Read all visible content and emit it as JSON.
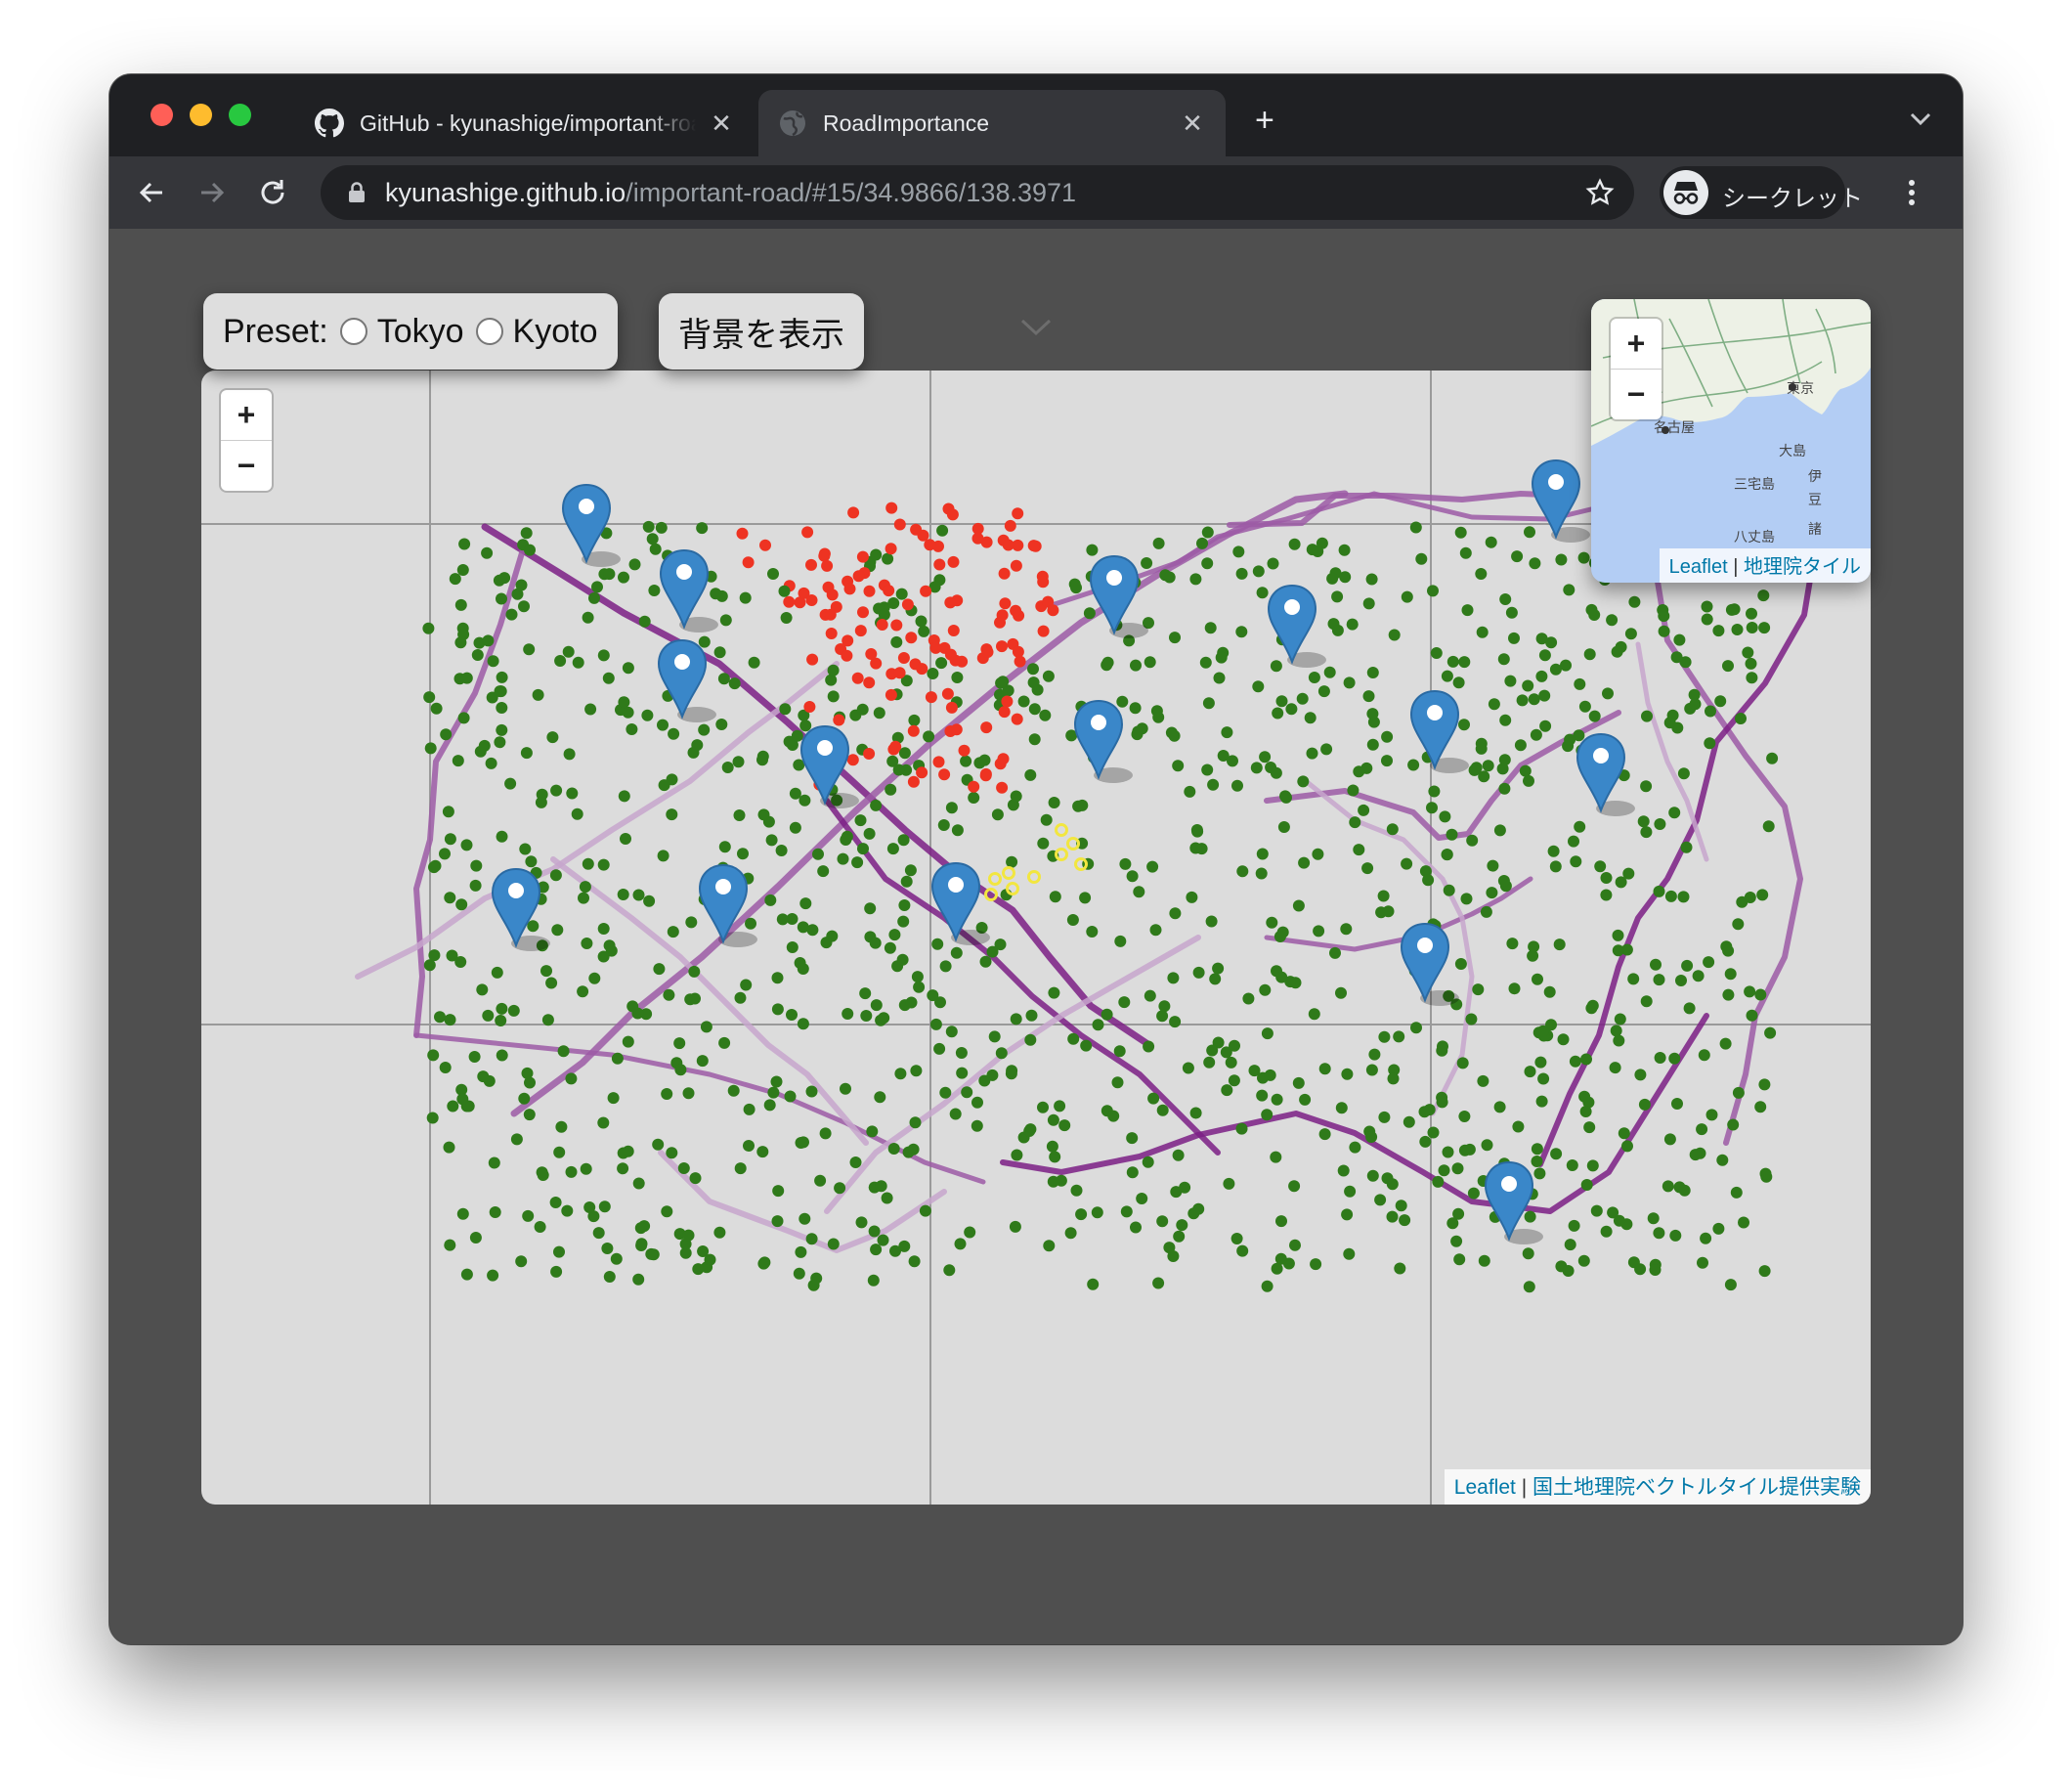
{
  "browser": {
    "tabs": [
      {
        "title": "GitHub - kyunashige/important-road",
        "active": false,
        "icon": "github-icon"
      },
      {
        "title": "RoadImportance",
        "active": true,
        "icon": "globe-icon"
      }
    ],
    "new_tab_symbol": "+",
    "url_host": "kyunashige.github.io",
    "url_path": "/important-road/#15/34.9866/138.3971",
    "profile_label": "シークレット"
  },
  "controls": {
    "preset_label": "Preset:",
    "preset_options": [
      "Tokyo",
      "Kyoto"
    ],
    "background_button": "背景を表示"
  },
  "map": {
    "zoom_in": "+",
    "zoom_out": "−",
    "attribution": {
      "leaflet": "Leaflet",
      "separator": "|",
      "source": "国土地理院ベクトルタイル提供実験"
    },
    "colors": {
      "background": "#dcdcdc",
      "grid": "#9a9a9a",
      "road_strong": "#7b1f85",
      "road_medium": "#9c5aa6",
      "road_light": "#c7a6cc",
      "point_green": "#2f7a1a",
      "point_red": "#ee3322",
      "point_yellow": "#f2e640",
      "marker": "#3a87c9"
    }
  },
  "minimap": {
    "zoom_in": "+",
    "zoom_out": "−",
    "place_labels": [
      "東京",
      "名古屋",
      "大島",
      "三宅島",
      "伊",
      "豆",
      "八丈島",
      "諸"
    ],
    "attribution": {
      "leaflet": "Leaflet",
      "separator": "|",
      "source": "地理院タイル"
    }
  }
}
